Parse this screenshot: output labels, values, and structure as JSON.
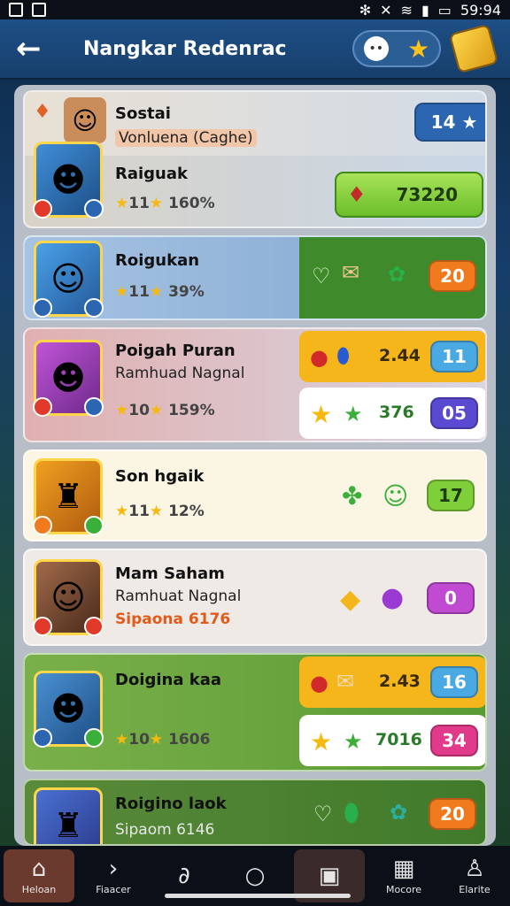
{
  "status": {
    "time": "59:94"
  },
  "header": {
    "title": "Nangkar Redenrac",
    "pill_dot": "••"
  },
  "cards": [
    {
      "header_name": "Sostai",
      "header_sub": "Vonluena (Caghe)",
      "header_count": "14",
      "name": "Raiguak",
      "stars": "11",
      "pct": "160%",
      "reward_value": "73220"
    },
    {
      "name": "Roigukan",
      "stars": "11",
      "pct": "39%",
      "count": "20"
    },
    {
      "name": "Poigah Puran",
      "sub": "Ramhuad Nagnal",
      "stars": "10",
      "pct": "159%",
      "top_value": "2.44",
      "top_count": "11",
      "bottom_value": "376",
      "bottom_count": "05"
    },
    {
      "name": "Son hgaik",
      "stars": "11",
      "pct": "12%",
      "count": "17"
    },
    {
      "name": "Mam Saham",
      "sub": "Ramhuat Nagnal",
      "extra": "Sipaona 6176",
      "count": "0"
    },
    {
      "name": "Doigina kaa",
      "stars": "10",
      "pct": "1606",
      "top_value": "2.43",
      "top_count": "16",
      "bottom_value": "7016",
      "bottom_count": "34"
    },
    {
      "name": "Roigino laok",
      "sub": "Sipaom 6146",
      "count": "20"
    }
  ],
  "nav": [
    {
      "label": "Heloan",
      "icon": "house-icon",
      "glyph": "⌂"
    },
    {
      "label": "Fiaacer",
      "icon": "chevron-right-icon",
      "glyph": "›"
    },
    {
      "label": "",
      "icon": "leaf-icon",
      "glyph": "∂"
    },
    {
      "label": "",
      "icon": "circle-icon",
      "glyph": "○"
    },
    {
      "label": "",
      "icon": "card-icon",
      "glyph": "▣"
    },
    {
      "label": "Mocore",
      "icon": "calendar-icon",
      "glyph": "▦"
    },
    {
      "label": "Elarite",
      "icon": "profile-icon",
      "glyph": "♙"
    }
  ],
  "colors": {
    "accent": "#1e4f86",
    "gold": "#ffc21a",
    "green": "#7ecf3a"
  }
}
